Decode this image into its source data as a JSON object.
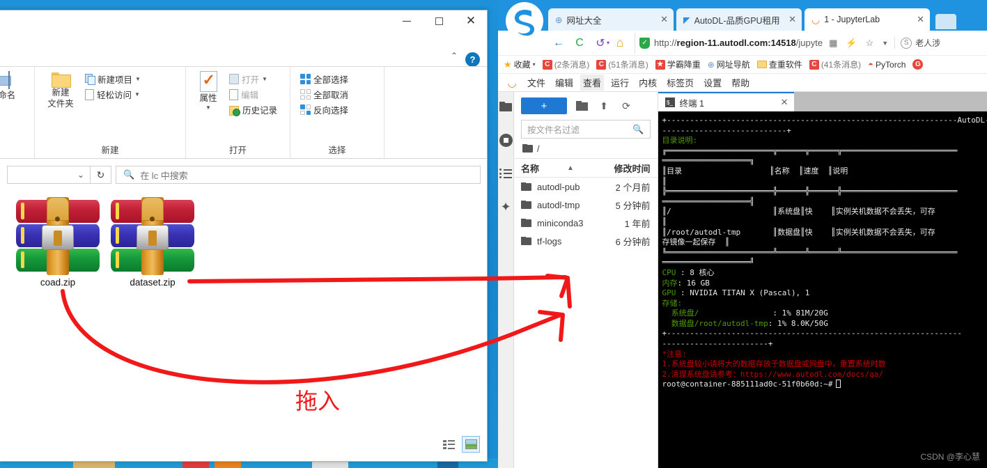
{
  "explorer": {
    "window_title": "",
    "window_buttons": {
      "minimize": "—",
      "maximize": "▢",
      "close": "✕"
    },
    "ribbon_collapse": "⌃",
    "help": "?",
    "groups": [
      {
        "label": "新建",
        "big": [
          {
            "label_line1": "新建",
            "label_line2": "文件夹",
            "icon": "folder-icon"
          }
        ],
        "small": [
          {
            "label": "新建项目",
            "icon": "copy-icon",
            "has_caret": true,
            "dim": false
          },
          {
            "label": "轻松访问",
            "icon": "page-icon",
            "has_caret": true,
            "dim": false
          }
        ]
      },
      {
        "label": "打开",
        "big": [
          {
            "label_line1": "属性",
            "label_line2": "",
            "icon": "properties-icon"
          }
        ],
        "small": [
          {
            "label": "打开",
            "icon": "open-icon",
            "has_caret": true,
            "dim": true
          },
          {
            "label": "编辑",
            "icon": "edit-icon",
            "has_caret": false,
            "dim": true
          },
          {
            "label": "历史记录",
            "icon": "history-icon",
            "has_caret": false,
            "dim": false
          }
        ]
      },
      {
        "label": "选择",
        "big": [],
        "small": [
          {
            "label": "全部选择",
            "icon": "select-all-icon",
            "has_caret": false,
            "dim": false
          },
          {
            "label": "全部取消",
            "icon": "select-none-icon",
            "has_caret": false,
            "dim": false
          },
          {
            "label": "反向选择",
            "icon": "invert-selection-icon",
            "has_caret": false,
            "dim": false
          }
        ]
      }
    ],
    "rename_label": "重命名",
    "address": {
      "dropdown": "⌄",
      "refresh": "↻"
    },
    "search": {
      "placeholder": "在 lc 中搜索",
      "icon": "search-icon"
    },
    "files": [
      {
        "name": "coad.zip",
        "icon": "zip-archive-icon"
      },
      {
        "name": "dataset.zip",
        "icon": "zip-archive-icon"
      }
    ],
    "view_buttons": [
      {
        "name": "details-view",
        "active": false
      },
      {
        "name": "large-icons-view",
        "active": true
      }
    ]
  },
  "browser": {
    "tabs": [
      {
        "title": "网址大全",
        "icon": "globe-icon",
        "active": false,
        "close": "✕"
      },
      {
        "title": "AutoDL-品质GPU租用平",
        "icon": "autodl-icon",
        "active": false,
        "close": "✕"
      },
      {
        "title": "1 - JupyterLab",
        "icon": "jupyter-icon",
        "active": true,
        "close": "✕"
      }
    ],
    "nav": {
      "back": "←",
      "reload": "C",
      "undo": "↺",
      "home": "⌂",
      "undo_caret": "▾"
    },
    "url": {
      "scheme": "http://",
      "host": "region-11.autodl.com:14518",
      "path": "/jupyte",
      "shield_icon": "shield-icon",
      "qr_icon": "qr-code-icon",
      "lightning_icon": "lightning-icon",
      "star_icon": "star-icon",
      "caret_icon": "chevron-down-icon"
    },
    "account": {
      "icon": "sogou-icon",
      "label": "老人涉"
    },
    "bookmarks": [
      {
        "label": "收藏",
        "icon": "star-icon",
        "caret": "▾"
      },
      {
        "label": "(2条消息)",
        "icon": "csdn-icon"
      },
      {
        "label": "(51条消息)",
        "icon": "csdn-icon"
      },
      {
        "label": "学霸降重",
        "icon": "star-red-icon"
      },
      {
        "label": "网址导航",
        "icon": "globe-icon"
      },
      {
        "label": "查重软件",
        "icon": "folder-icon"
      },
      {
        "label": "(41条消息)",
        "icon": "csdn-icon"
      },
      {
        "label": "PyTorch",
        "icon": "pytorch-icon"
      },
      {
        "label": "",
        "icon": "g-circle-icon"
      }
    ]
  },
  "jupyter": {
    "menu": [
      {
        "label": "文件",
        "selected": false
      },
      {
        "label": "编辑",
        "selected": false
      },
      {
        "label": "查看",
        "selected": true
      },
      {
        "label": "运行",
        "selected": false
      },
      {
        "label": "内核",
        "selected": false
      },
      {
        "label": "标签页",
        "selected": false
      },
      {
        "label": "设置",
        "selected": false
      },
      {
        "label": "帮助",
        "selected": false
      }
    ],
    "rail_icons": [
      "folder-icon",
      "running-terminals-icon",
      "commands-list-icon",
      "extensions-puzzle-icon"
    ],
    "filebrowser": {
      "new_button": "+",
      "toolbar_icons": [
        "new-folder-icon",
        "upload-icon",
        "refresh-icon"
      ],
      "filter_placeholder": "按文件名过滤",
      "breadcrumb": "/",
      "columns": {
        "name": "名称",
        "sort_caret": "▲",
        "modified": "修改时间"
      },
      "rows": [
        {
          "name": "autodl-pub",
          "modified": "2 个月前",
          "icon": "folder-icon"
        },
        {
          "name": "autodl-tmp",
          "modified": "5 分钟前",
          "icon": "folder-icon"
        },
        {
          "name": "miniconda3",
          "modified": "1 年前",
          "icon": "folder-icon"
        },
        {
          "name": "tf-logs",
          "modified": "6 分钟前",
          "icon": "folder-icon"
        }
      ]
    },
    "terminal_tab": {
      "title": "终端 1",
      "icon": "terminal-icon",
      "close": "✕"
    },
    "terminal": {
      "rule_top": "+---------------------------------------------------------------AutoDL-",
      "rule_top2": "---------------------------+",
      "dir_header": "目录说明:",
      "table_top": "╔═══════════════════════╦══════╦══════╦═════════════════════════",
      "table_top2": "═══════════════════╗",
      "table_head_cells": "║目录                   ║名称  ║速度  ║说明",
      "table_head_tail": "║",
      "table_div": "╠═══════════════════════╬══════╬══════╬═════════════════════════",
      "table_div2": "═══════════════════╣",
      "row1": "║/                      ║系统盘║快    ║实例关机数据不会丢失，可存",
      "row1b": "║",
      "row2": "║/root/autodl-tmp       ║数据盘║快    ║实例关机数据不会丢失，可存",
      "row2b": "存镜像一起保存  ║",
      "table_bot": "╚═══════════════════════╩══════╩══════╩═════════════════════════",
      "table_bot2": "═══════════════════╝",
      "cpu_label": "CPU",
      "cpu_value": " : 8 核心",
      "mem_label": "内存",
      "mem_value": ": 16 GB",
      "gpu_label": "GPU",
      "gpu_value": " : NVIDIA TITAN X (Pascal), 1",
      "storage_label": "存储:",
      "sysdisk_label": "  系统盘/",
      "sysdisk_value": "                : 1% 81M/20G",
      "datadisk_label": "  数据盘",
      "datadisk_path": "/root/autodl-tmp",
      "datadisk_value": ": 1% 8.0K/50G",
      "rule_bottom": "+----------------------------------------------------------------",
      "rule_bottom2": "-----------------------+",
      "note_header": "*注意:",
      "note1": "1.系统盘较小请将大的数据存放于数据盘或网盘中，重置系统时数",
      "note2_pre": "2.清理系统盘请参考：",
      "note2_url": "https://www.autodl.com/docs/qa/",
      "prompt": "root@container-885111ad0c-51f0b60d:~#"
    }
  },
  "annotations": {
    "drag_label": "拖入",
    "color": "#f01818"
  },
  "watermark": "CSDN @李心慧"
}
